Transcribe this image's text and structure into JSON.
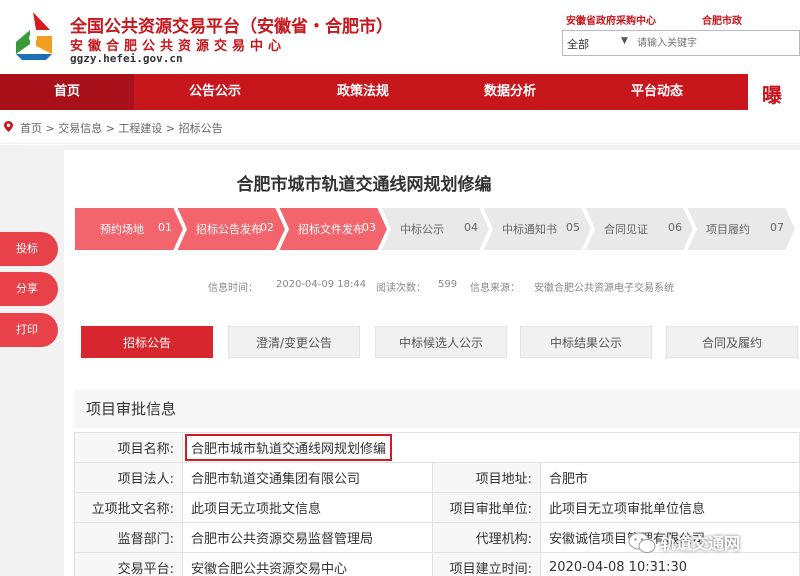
{
  "header": {
    "title": "全国公共资源交易平台（安徽省・合肥市）",
    "subtitle": "安徽合肥公共资源交易中心",
    "url": "ggzy.hefei.gov.cn",
    "top_link_1": "安徽省政府采购中心",
    "top_link_2": "合肥市政",
    "search_select": "全部",
    "search_placeholder": "请输入关键字"
  },
  "nav": {
    "items": [
      "首页",
      "公告公示",
      "政策法规",
      "数据分析",
      "平台动态"
    ],
    "deco": "曝光"
  },
  "breadcrumb": "首页 > 交易信息 > 工程建设 > 招标公告",
  "page_title": "合肥市城市轨道交通线网规划修编",
  "steps": [
    {
      "label": "预约场地",
      "num": "01"
    },
    {
      "label": "招标公告发布",
      "num": "02"
    },
    {
      "label": "招标文件发布",
      "num": "03"
    },
    {
      "label": "中标公示",
      "num": "04"
    },
    {
      "label": "中标通知书",
      "num": "05"
    },
    {
      "label": "合同见证",
      "num": "06"
    },
    {
      "label": "项目履约",
      "num": "07"
    }
  ],
  "steps_active_count": 3,
  "colors": {
    "primary": "#c8161d",
    "step_active": "#f2656c",
    "step_inactive": "#e9e9e9"
  },
  "meta": {
    "time_label": "信息时间：",
    "time_value": "2020-04-09 18:44",
    "views_label": "阅读次数：",
    "views_value": "599",
    "source_label": "信息来源：",
    "source_value": "安徽合肥公共资源电子交易系统"
  },
  "side_buttons": [
    "投标",
    "分享",
    "打印"
  ],
  "tabs": [
    "招标公告",
    "澄清/变更公告",
    "中标候选人公示",
    "中标结果公示",
    "合同及履约"
  ],
  "section_title": "项目审批信息",
  "info": {
    "project_name_label": "项目名称:",
    "project_name": "合肥市城市轨道交通线网规划修编",
    "legal_person_label": "项目法人:",
    "legal_person": "合肥市轨道交通集团有限公司",
    "address_label": "项目地址:",
    "address": "合肥市",
    "approval_doc_label": "立项批文名称:",
    "approval_doc": "此项目无立项批文信息",
    "approval_unit_label": "项目审批单位:",
    "approval_unit": "此项目无立项审批单位信息",
    "supervisor_label": "监督部门:",
    "supervisor": "合肥市公共资源交易监督管理局",
    "agency_label": "代理机构:",
    "agency": "安徽诚信项目管理有限公司",
    "platform_label": "交易平台:",
    "platform": "安徽合肥公共资源交易中心",
    "created_label": "项目建立时间:",
    "created": "2020-04-08 10:31:30"
  },
  "watermark": "轨道交通网"
}
